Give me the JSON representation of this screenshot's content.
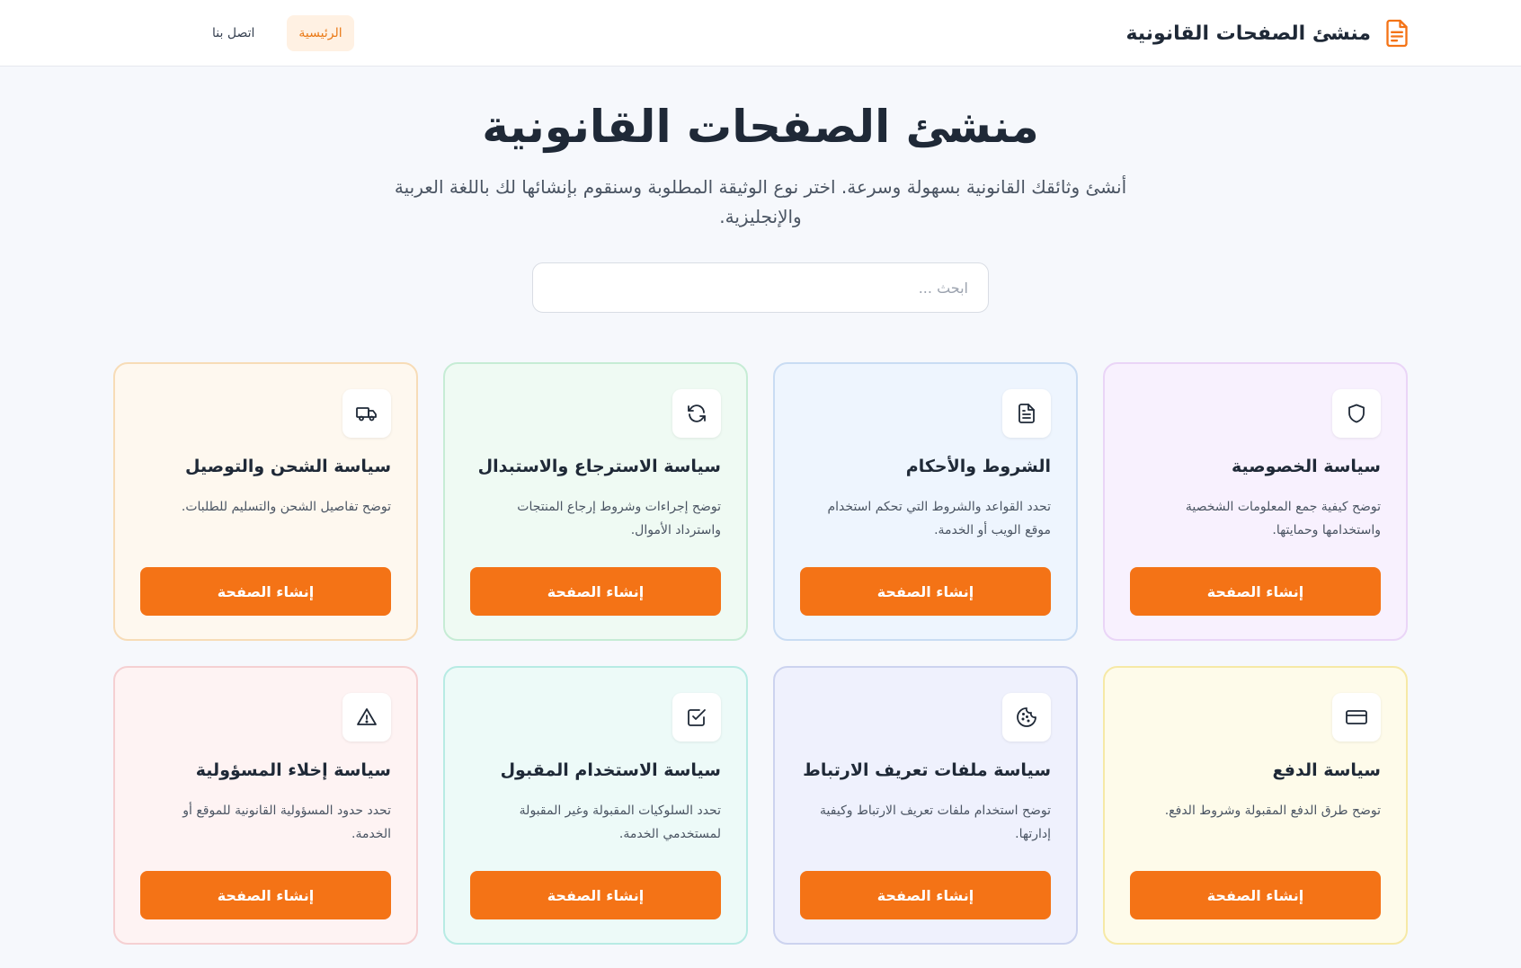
{
  "header": {
    "brand_title": "منشئ الصفحات القانونية",
    "brand_icon": "document-icon",
    "nav": [
      {
        "label": "الرئيسية",
        "active": true
      },
      {
        "label": "اتصل بنا",
        "active": false
      }
    ]
  },
  "hero": {
    "title": "منشئ الصفحات القانونية",
    "subtitle": "أنشئ وثائقك القانونية بسهولة وسرعة. اختر نوع الوثيقة المطلوبة وسنقوم بإنشائها لك باللغة العربية والإنجليزية."
  },
  "search": {
    "placeholder": "ابحث ..."
  },
  "colors": {
    "accent": "#f47316",
    "nav_active_bg": "#fff1e3",
    "nav_active_text": "#ea7a18"
  },
  "cards": [
    {
      "title": "سياسة الخصوصية",
      "description": "توضح كيفية جمع المعلومات الشخصية واستخدامها وحمايتها.",
      "icon": "shield-icon",
      "button_label": "إنشاء الصفحة",
      "bg": "#f8f1fe",
      "border": "#ead5f7"
    },
    {
      "title": "الشروط والأحكام",
      "description": "تحدد القواعد والشروط التي تحكم استخدام موقع الويب أو الخدمة.",
      "icon": "file-text-icon",
      "button_label": "إنشاء الصفحة",
      "bg": "#eef5fe",
      "border": "#c9dcf3"
    },
    {
      "title": "سياسة الاسترجاع والاستبدال",
      "description": "توضح إجراءات وشروط إرجاع المنتجات واسترداد الأموال.",
      "icon": "refresh-icon",
      "button_label": "إنشاء الصفحة",
      "bg": "#effaf3",
      "border": "#c6ecd5"
    },
    {
      "title": "سياسة الشحن والتوصيل",
      "description": "توضح تفاصيل الشحن والتسليم للطلبات.",
      "icon": "truck-icon",
      "button_label": "إنشاء الصفحة",
      "bg": "#fef8ef",
      "border": "#f7dcb7"
    },
    {
      "title": "سياسة الدفع",
      "description": "توضح طرق الدفع المقبولة وشروط الدفع.",
      "icon": "credit-card-icon",
      "button_label": "إنشاء الصفحة",
      "bg": "#fefbea",
      "border": "#f6e9a6"
    },
    {
      "title": "سياسة ملفات تعريف الارتباط",
      "description": "توضح استخدام ملفات تعريف الارتباط وكيفية إدارتها.",
      "icon": "cookie-icon",
      "button_label": "إنشاء الصفحة",
      "bg": "#eff1fd",
      "border": "#ccd3ef"
    },
    {
      "title": "سياسة الاستخدام المقبول",
      "description": "تحدد السلوكيات المقبولة وغير المقبولة لمستخدمي الخدمة.",
      "icon": "check-square-icon",
      "button_label": "إنشاء الصفحة",
      "bg": "#edfaf8",
      "border": "#b7ebe4"
    },
    {
      "title": "سياسة إخلاء المسؤولية",
      "description": "تحدد حدود المسؤولية القانونية للموقع أو الخدمة.",
      "icon": "alert-triangle-icon",
      "button_label": "إنشاء الصفحة",
      "bg": "#fef3f3",
      "border": "#f5d0d2"
    }
  ]
}
